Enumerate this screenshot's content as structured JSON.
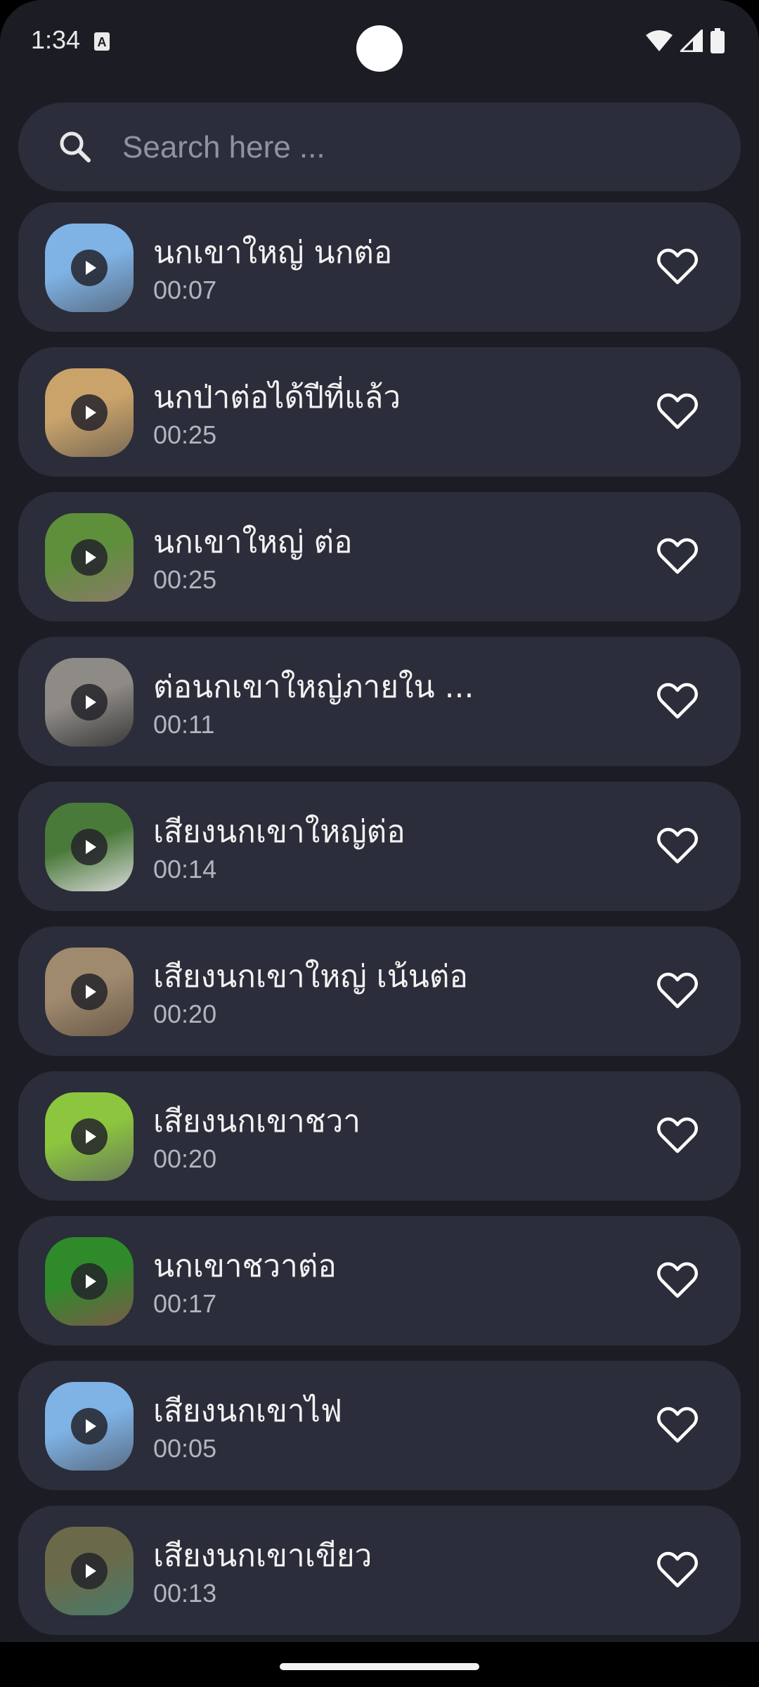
{
  "status": {
    "time": "1:34",
    "notification_icon": "a-badge-icon"
  },
  "search": {
    "placeholder": "Search here ..."
  },
  "items": [
    {
      "title": "นกเขาใหญ่ นกต่อ",
      "duration": "00:07",
      "thumb_colors": [
        "#7fb3e6",
        "#5a6e86"
      ]
    },
    {
      "title": "นกป่าต่อได้ปีที่แล้ว",
      "duration": "00:25",
      "thumb_colors": [
        "#c9a36a",
        "#7a6a55"
      ]
    },
    {
      "title": "นกเขาใหญ่ ต่อ",
      "duration": "00:25",
      "thumb_colors": [
        "#5e8f3a",
        "#8a7a6a"
      ]
    },
    {
      "title": "ต่อนกเขาใหญ่ภายใน ...",
      "duration": "00:11",
      "thumb_colors": [
        "#8e8a86",
        "#3a3a3a"
      ]
    },
    {
      "title": "เสียงนกเขาใหญ่ต่อ",
      "duration": "00:14",
      "thumb_colors": [
        "#4a7a3a",
        "#d8d8d8"
      ]
    },
    {
      "title": "เสียงนกเขาใหญ่ เน้นต่อ",
      "duration": "00:20",
      "thumb_colors": [
        "#a08a6e",
        "#6a5a4a"
      ]
    },
    {
      "title": "เสียงนกเขาชวา",
      "duration": "00:20",
      "thumb_colors": [
        "#8cc63e",
        "#6a7a5a"
      ]
    },
    {
      "title": "นกเขาชวาต่อ",
      "duration": "00:17",
      "thumb_colors": [
        "#2f8a2a",
        "#7a5a4a"
      ]
    },
    {
      "title": "เสียงนกเขาไฟ",
      "duration": "00:05",
      "thumb_colors": [
        "#7fb3e6",
        "#5a6e86"
      ]
    },
    {
      "title": "เสียงนกเขาเขียว",
      "duration": "00:13",
      "thumb_colors": [
        "#6a6a4a",
        "#4a7a6a"
      ]
    }
  ]
}
